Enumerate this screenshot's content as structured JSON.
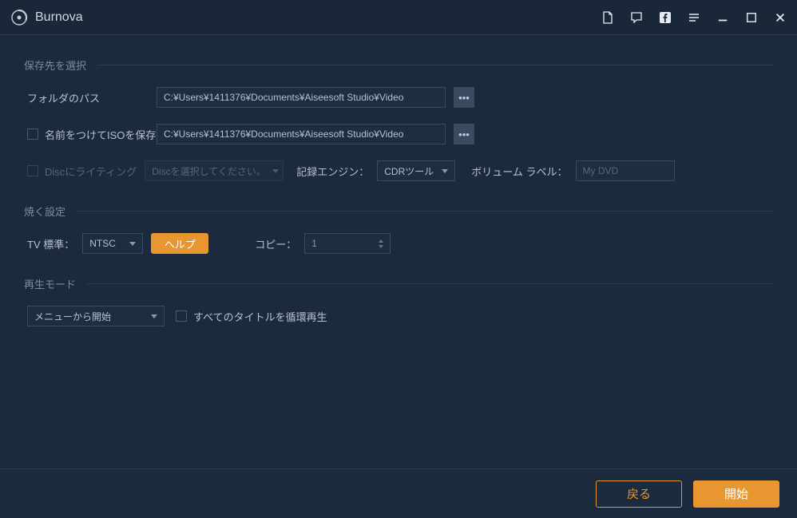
{
  "app": {
    "name": "Burnova"
  },
  "sections": {
    "save_dest": {
      "title": "保存先を選択",
      "folder_label": "フォルダのパス",
      "folder_path": "C:¥Users¥1411376¥Documents¥Aiseesoft Studio¥Video",
      "iso_checkbox_label": "名前をつけてISOを保存",
      "iso_path": "C:¥Users¥1411376¥Documents¥Aiseesoft Studio¥Video",
      "disc_checkbox_label": "Discにライティング",
      "disc_dropdown_value": "Discを選択してください。",
      "engine_label": "記録エンジン：",
      "engine_value": "CDRツール",
      "volume_label": "ボリューム ラベル：",
      "volume_placeholder": "My DVD"
    },
    "burn_settings": {
      "title": "焼く設定",
      "tv_label": "TV 標準：",
      "tv_value": "NTSC",
      "help_label": "ヘルプ",
      "copy_label": "コピー：",
      "copy_value": "1"
    },
    "play_mode": {
      "title": "再生モード",
      "mode_value": "メニューから開始",
      "loop_label": "すべてのタイトルを循環再生"
    }
  },
  "footer": {
    "back": "戻る",
    "start": "開始"
  }
}
